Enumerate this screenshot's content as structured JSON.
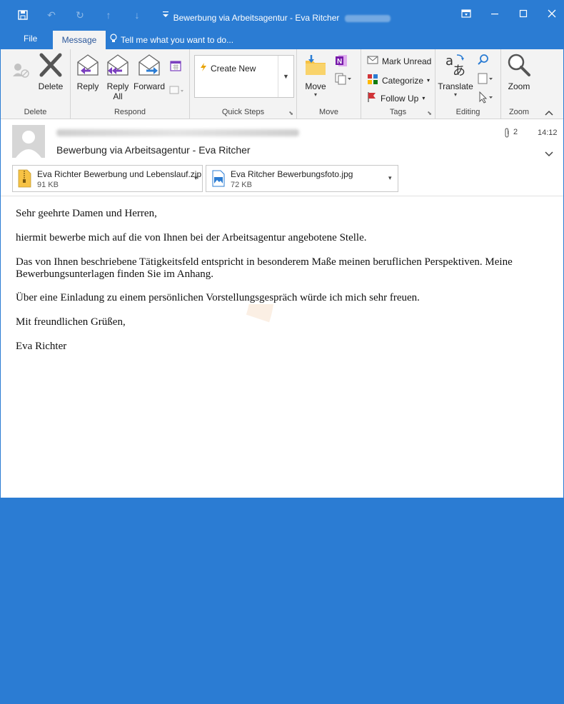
{
  "window": {
    "title": "Bewerbung via Arbeitsagentur - Eva Ritcher"
  },
  "tabs": {
    "file": "File",
    "message": "Message",
    "tell_me": "Tell me what you want to do..."
  },
  "ribbon": {
    "delete_group": {
      "label": "Delete",
      "delete": "Delete"
    },
    "respond_group": {
      "label": "Respond",
      "reply": "Reply",
      "reply_all_1": "Reply",
      "reply_all_2": "All",
      "forward": "Forward"
    },
    "quick_steps_group": {
      "label": "Quick Steps",
      "create_new": "Create New"
    },
    "move_group": {
      "label": "Move",
      "move": "Move"
    },
    "tags_group": {
      "label": "Tags",
      "mark_unread": "Mark Unread",
      "categorize": "Categorize",
      "follow_up": "Follow Up"
    },
    "editing_group": {
      "label": "Editing",
      "translate": "Translate"
    },
    "zoom_group": {
      "label": "Zoom",
      "zoom": "Zoom"
    }
  },
  "message": {
    "subject": "Bewerbung via Arbeitsagentur - Eva Ritcher",
    "attachment_count": "2",
    "time": "14:12",
    "attachments": [
      {
        "name": "Eva Richter Bewerbung und Lebenslauf.zip",
        "size": "91 KB"
      },
      {
        "name": "Eva Ritcher Bewerbungsfoto.jpg",
        "size": "72 KB"
      }
    ],
    "body": [
      "Sehr geehrte Damen und Herren,",
      "hiermit bewerbe mich auf die von Ihnen bei der Arbeitsagentur angebotene Stelle.",
      "Das von Ihnen beschriebene Tätigkeitsfeld entspricht in besonderem Maße meinen beruflichen Perspektiven. Meine Bewerbungsunterlagen finden Sie im Anhang.",
      "Über eine Einladung zu einem persönlichen Vorstellungsgespräch würde ich mich sehr freuen.",
      "Mit freundlichen Grüßen,",
      "Eva Richter"
    ]
  },
  "colors": {
    "accent": "#2b7cd3",
    "ribbon_bg": "#f3f3f3"
  }
}
